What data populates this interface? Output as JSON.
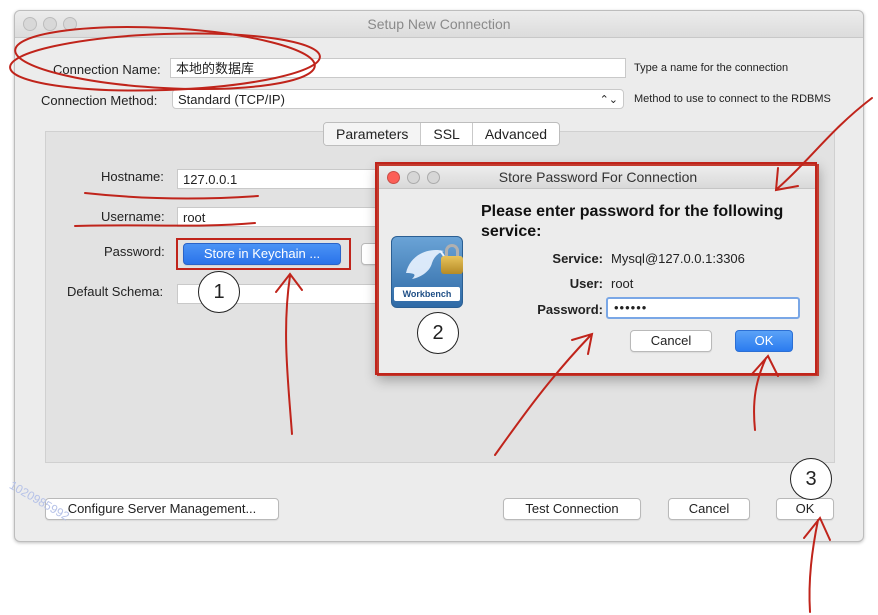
{
  "window": {
    "title": "Setup New Connection",
    "connection_name": {
      "label": "Connection Name:",
      "value": "本地的数据库",
      "hint": "Type a name for the connection"
    },
    "connection_method": {
      "label": "Connection Method:",
      "value": "Standard (TCP/IP)",
      "hint": "Method to use to connect to the RDBMS"
    },
    "tabs": [
      "Parameters",
      "SSL",
      "Advanced"
    ],
    "active_tab": "Parameters",
    "hostname": {
      "label": "Hostname:",
      "value": "127.0.0.1"
    },
    "username": {
      "label": "Username:",
      "value": "root"
    },
    "password": {
      "label": "Password:",
      "button": "Store in Keychain ..."
    },
    "default_schema": {
      "label": "Default Schema:",
      "value": ""
    },
    "buttons": {
      "configure": "Configure Server Management...",
      "test": "Test Connection",
      "cancel": "Cancel",
      "ok": "OK"
    }
  },
  "dialog": {
    "title": "Store Password For Connection",
    "heading": "Please enter password for the following service:",
    "service_label": "Service:",
    "service_value": "Mysql@127.0.0.1:3306",
    "user_label": "User:",
    "user_value": "root",
    "password_label": "Password:",
    "password_value": "••••••",
    "cancel": "Cancel",
    "ok": "OK",
    "logo_text": "Workbench"
  },
  "annotations": {
    "step1": "1",
    "step2": "2",
    "step3": "3"
  },
  "watermark": "1020985992",
  "colors": {
    "annotation_red": "#c0241b",
    "ok_blue": "#2b7bef",
    "keychain_blue": "#2f7bf0"
  }
}
